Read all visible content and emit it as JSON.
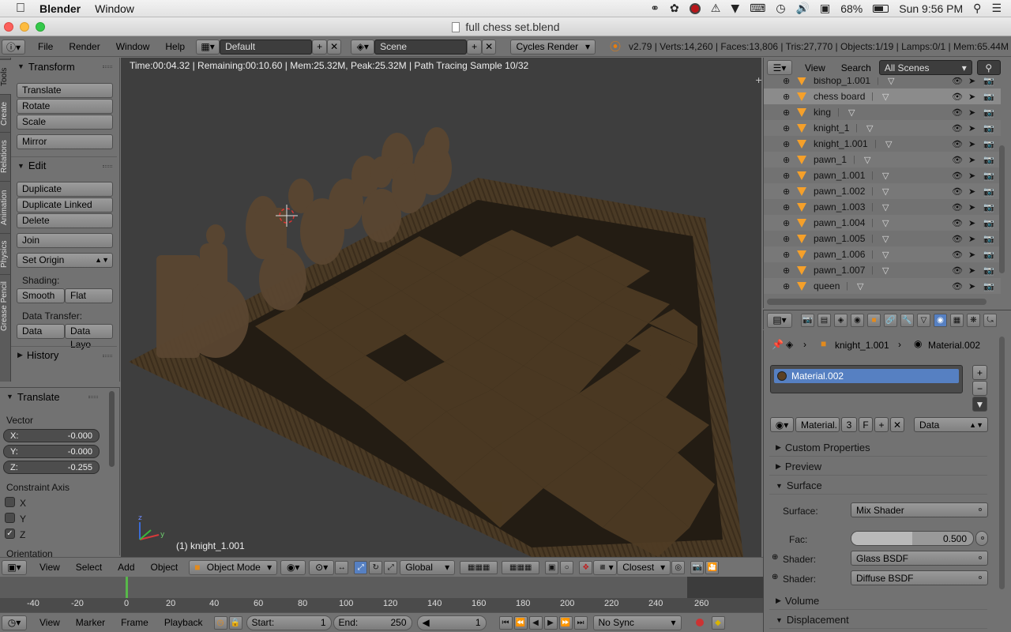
{
  "menubar": {
    "apple_icon": "apple-icon",
    "app": "Blender",
    "window": "Window",
    "battery": "68%",
    "clock": "Sun 9:56 PM"
  },
  "titlebar": {
    "title": "full chess set.blend"
  },
  "info_header": {
    "menus": [
      "File",
      "Render",
      "Window",
      "Help"
    ],
    "layout": "Default",
    "scene": "Scene",
    "engine": "Cycles Render",
    "stats": "v2.79 | Verts:14,260 | Faces:13,806 | Tris:27,770 | Objects:1/19 | Lamps:0/1 | Mem:65.44M | k"
  },
  "tool_tabs": [
    "Tools",
    "Create",
    "Relations",
    "Animation",
    "Physics",
    "Grease Pencil"
  ],
  "tool_shelf": {
    "transform_title": "Transform",
    "translate": "Translate",
    "rotate": "Rotate",
    "scale": "Scale",
    "mirror": "Mirror",
    "edit_title": "Edit",
    "duplicate": "Duplicate",
    "duplicate_linked": "Duplicate Linked",
    "delete": "Delete",
    "join": "Join",
    "set_origin": "Set Origin",
    "shading_label": "Shading:",
    "smooth": "Smooth",
    "flat": "Flat",
    "data_transfer_label": "Data Transfer:",
    "data": "Data",
    "data_layout": "Data Layo",
    "history": "History"
  },
  "operator_panel": {
    "title": "Translate",
    "vector_label": "Vector",
    "x": "X:",
    "x_val": "-0.000",
    "y": "Y:",
    "y_val": "-0.000",
    "z": "Z:",
    "z_val": "-0.255",
    "constraint_label": "Constraint Axis",
    "cx": "X",
    "cy": "Y",
    "cz": "Z",
    "cz_checked": true,
    "orientation": "Orientation"
  },
  "viewport": {
    "status": "Time:00:04.32 | Remaining:00:10.60 | Mem:25.32M, Peak:25.32M | Path Tracing Sample 10/32",
    "active_object": "(1) knight_1.001"
  },
  "view3d_header": {
    "menus": [
      "View",
      "Select",
      "Add",
      "Object"
    ],
    "mode": "Object Mode",
    "orientation": "Global",
    "snap": "Closest"
  },
  "timeline": {
    "ticks": [
      "-40",
      "-20",
      "0",
      "20",
      "40",
      "60",
      "80",
      "100",
      "120",
      "140",
      "160",
      "180",
      "200",
      "220",
      "240",
      "260"
    ],
    "current_frame_marker": 0,
    "menus": [
      "View",
      "Marker",
      "Frame",
      "Playback"
    ],
    "start_label": "Start:",
    "start": "1",
    "end_label": "End:",
    "end": "250",
    "current": "1",
    "sync": "No Sync"
  },
  "outliner": {
    "view": "View",
    "search": "Search",
    "filter": "All Scenes",
    "items": [
      {
        "name": "bishop_1.001"
      },
      {
        "name": "chess board"
      },
      {
        "name": "king"
      },
      {
        "name": "knight_1"
      },
      {
        "name": "knight_1.001"
      },
      {
        "name": "pawn_1"
      },
      {
        "name": "pawn_1.001"
      },
      {
        "name": "pawn_1.002"
      },
      {
        "name": "pawn_1.003"
      },
      {
        "name": "pawn_1.004"
      },
      {
        "name": "pawn_1.005"
      },
      {
        "name": "pawn_1.006"
      },
      {
        "name": "pawn_1.007"
      },
      {
        "name": "queen"
      }
    ]
  },
  "properties": {
    "breadcrumb_object": "knight_1.001",
    "breadcrumb_material": "Material.002",
    "slot_name": "Material.002",
    "material_field": "Material.",
    "users": "3",
    "fake": "F",
    "link": "Data",
    "panels": {
      "custom": "Custom Properties",
      "preview": "Preview",
      "surface": "Surface",
      "volume": "Volume",
      "displacement": "Displacement"
    },
    "surface_label": "Surface:",
    "surface_value": "Mix Shader",
    "fac_label": "Fac:",
    "fac_value": "0.500",
    "fac_fraction": 0.5,
    "shader_label": "Shader:",
    "shader1": "Glass BSDF",
    "shader2_label": "Shader:",
    "shader2": "Diffuse BSDF"
  },
  "colors": {
    "accent": "#5680c2",
    "mesh_icon": "#f5a02a",
    "playhead": "#58b84a"
  }
}
